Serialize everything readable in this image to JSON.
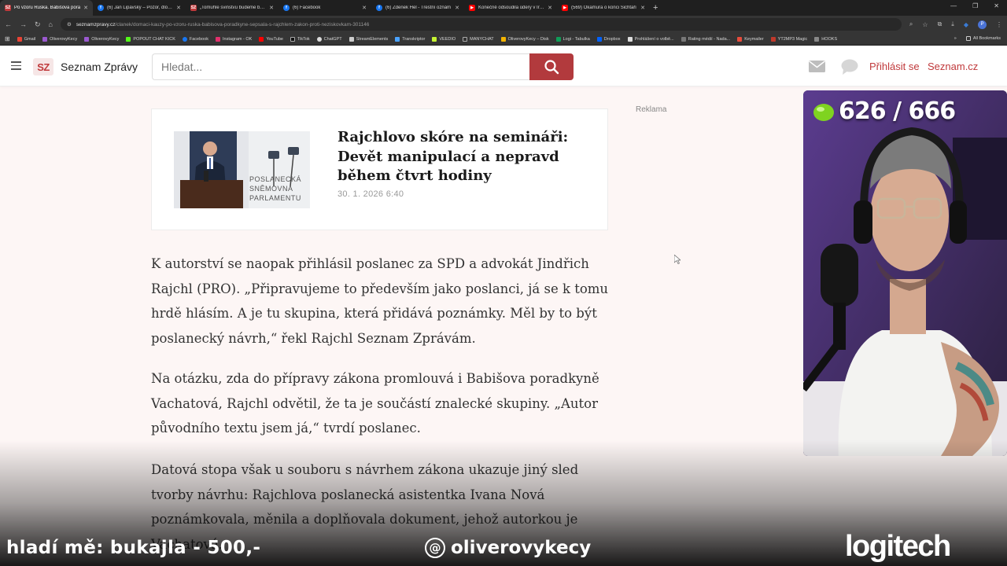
{
  "browser": {
    "tabs": [
      {
        "title": "Po vzoru Ruska. Babišova pora",
        "icon": "sz-icon",
        "active": true
      },
      {
        "title": "(6) Jan Lipavský – Pozor, dlouhé",
        "icon": "facebook-icon",
        "active": false
      },
      {
        "title": "„Tomuhle svinstvu budeme bráni",
        "icon": "sz-icon",
        "active": false
      },
      {
        "title": "(6) Facebook",
        "icon": "facebook-icon",
        "active": false
      },
      {
        "title": "(6) Zdenek Hel - Trestní oznám",
        "icon": "facebook-icon",
        "active": false
      },
      {
        "title": "Konečně odsoudila údery v Írán",
        "icon": "youtube-icon",
        "active": false
      },
      {
        "title": "(569) Okamura o konci Šichtaři",
        "icon": "youtube-icon",
        "active": false
      }
    ],
    "url_host": "seznamzpravy.cz",
    "url_path": "/clanek/domaci-kauzy-po-vzoru-ruska-babisova-poradkyne-sepsala-s-rajchlem-zakon-proti-neziskovkam-301146",
    "profile_initial": "P",
    "bookmarks": [
      "Gmail",
      "OliverovyKecy",
      "OliverovyKecy",
      "POPOUT CHAT KICK",
      "Facebook",
      "Instagram - OK",
      "YouTube",
      "TikTok",
      "ChatGPT",
      "StreamElements",
      "Transkriptor",
      "VEEDIO",
      "MANYCHAT",
      "OliverovyKecy – Disk",
      "Logi - Tabulka",
      "Dropbox",
      "Prohlášení o volbě...",
      "Rating médií - Nada...",
      "Keymailer",
      "YT2MP3 Magic",
      "HOOKS"
    ],
    "all_bookmarks": "All Bookmarks"
  },
  "header": {
    "logo_badge": "SZ",
    "logo_text": "Seznam Zprávy",
    "search_placeholder": "Hledat...",
    "login": "Přihlásit se",
    "seznam": "Seznam.cz"
  },
  "related_card": {
    "title": "Rajchlovo skóre na semináři: Devět manipulací a nepravd během čtvrt hodiny",
    "date": "30. 1. 2026 6:40",
    "thumb_sign_text": "POSLANECKÁ SNĚMOVNA PARLAMENTU"
  },
  "ad_label": "Reklama",
  "paragraphs": [
    "K autorství se naopak přihlásil poslanec za SPD a advokát Jindřich Rajchl (PRO). „Připravujeme to především jako poslanci, já se k tomu hrdě hlásím. A je tu skupina, která přidává poznámky. Měl by to být poslanecký návrh,“ řekl Rajchl Seznam Zprávám.",
    "Na otázku, zda do přípravy zákona promlouvá i Babišova poradkyně Vachatová, Rajchl odvětil, že ta je součástí znalecké skupiny. „Autor původního textu jsem já,“ tvrdí poslanec.",
    "Datová stopa však u souboru s návrhem zákona ukazuje jiný sled tvorby návrhu: Rajchlova poslanecká asistentka Ivana Nová poznámkovala, měnila a doplňovala dokument, jehož autorkou je Vachatová."
  ],
  "stream_overlay": {
    "counter": "626 / 666",
    "donation_text": "hladí mě: bukajla - 500,-",
    "handle": "oliverovykecy",
    "brand": "logitech"
  }
}
